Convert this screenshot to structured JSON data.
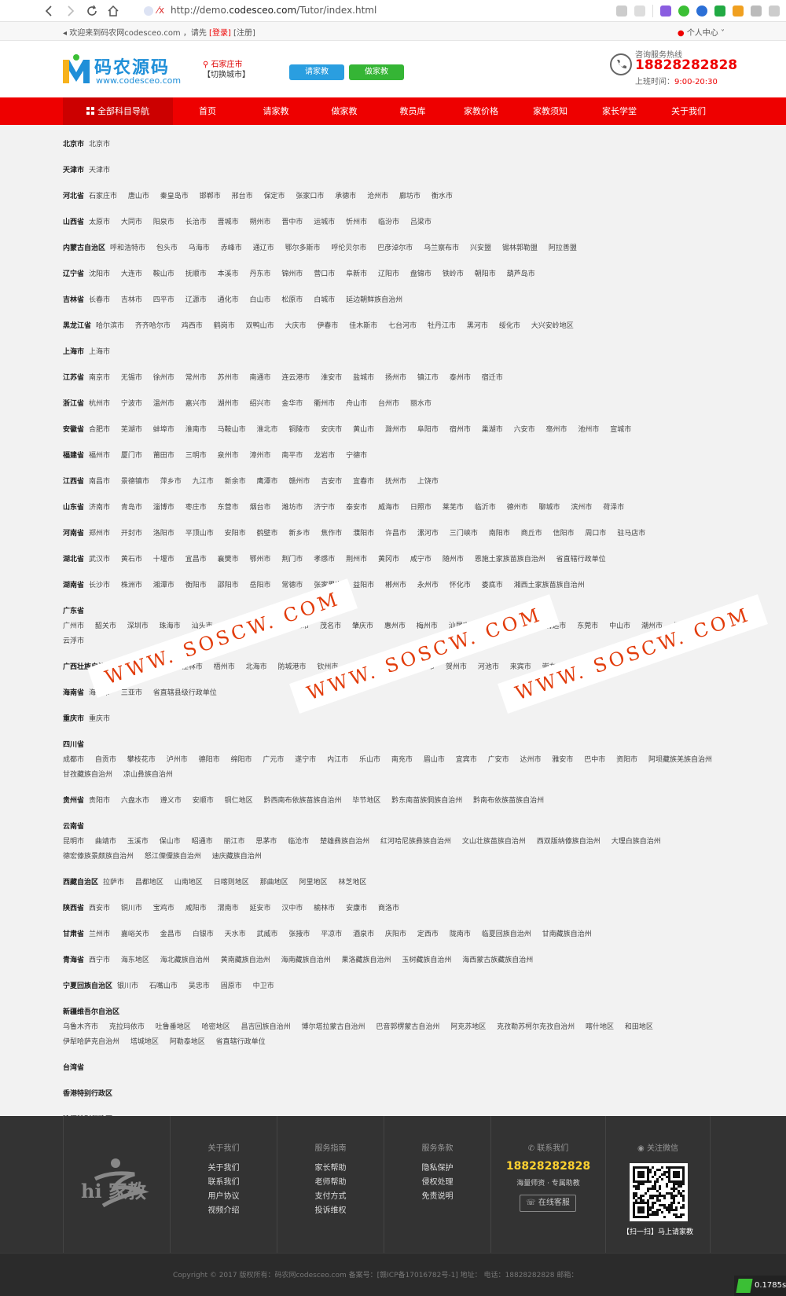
{
  "browser": {
    "url_prefix": "http://demo.",
    "url_host": "codesceo.com",
    "url_path": "/Tutor/index.html",
    "favicon_text": "⁄x"
  },
  "topbar": {
    "welcome": "欢迎来到码农网codesceo.com ，请先",
    "login": "[登录]",
    "register": "[注册]",
    "user_center": "个人中心"
  },
  "header": {
    "logo_title": "码农源码",
    "logo_url": "www.codesceo.com",
    "city_name": "石家庄市",
    "switch_city": "【切换城市】",
    "btn_hire": "请家教",
    "btn_tutor": "做家教",
    "hotline_label": "咨询服务热线",
    "hotline_number": "18828282828",
    "work_hours_label": "上班时间：",
    "work_hours": "9:00-20:30"
  },
  "nav": {
    "all": "全部科目导航",
    "items": [
      "首页",
      "请家教",
      "做家教",
      "教员库",
      "家教价格",
      "家教须知",
      "家长学堂",
      "关于我们"
    ]
  },
  "provinces": [
    {
      "name": "北京市",
      "cities": [
        "北京市"
      ]
    },
    {
      "name": "天津市",
      "cities": [
        "天津市"
      ]
    },
    {
      "name": "河北省",
      "cities": [
        "石家庄市",
        "唐山市",
        "秦皇岛市",
        "邯郸市",
        "邢台市",
        "保定市",
        "张家口市",
        "承德市",
        "沧州市",
        "廊坊市",
        "衡水市"
      ]
    },
    {
      "name": "山西省",
      "cities": [
        "太原市",
        "大同市",
        "阳泉市",
        "长治市",
        "晋城市",
        "朔州市",
        "晋中市",
        "运城市",
        "忻州市",
        "临汾市",
        "吕梁市"
      ]
    },
    {
      "name": "内蒙古自治区",
      "cities": [
        "呼和浩特市",
        "包头市",
        "乌海市",
        "赤峰市",
        "通辽市",
        "鄂尔多斯市",
        "呼伦贝尔市",
        "巴彦淖尔市",
        "乌兰察布市",
        "兴安盟",
        "锡林郭勒盟",
        "阿拉善盟"
      ]
    },
    {
      "name": "辽宁省",
      "cities": [
        "沈阳市",
        "大连市",
        "鞍山市",
        "抚顺市",
        "本溪市",
        "丹东市",
        "锦州市",
        "营口市",
        "阜新市",
        "辽阳市",
        "盘锦市",
        "铁岭市",
        "朝阳市",
        "葫芦岛市"
      ]
    },
    {
      "name": "吉林省",
      "cities": [
        "长春市",
        "吉林市",
        "四平市",
        "辽源市",
        "通化市",
        "白山市",
        "松原市",
        "白城市",
        "延边朝鲜族自治州"
      ]
    },
    {
      "name": "黑龙江省",
      "cities": [
        "哈尔滨市",
        "齐齐哈尔市",
        "鸡西市",
        "鹤岗市",
        "双鸭山市",
        "大庆市",
        "伊春市",
        "佳木斯市",
        "七台河市",
        "牡丹江市",
        "黑河市",
        "绥化市",
        "大兴安岭地区"
      ]
    },
    {
      "name": "上海市",
      "cities": [
        "上海市"
      ]
    },
    {
      "name": "江苏省",
      "cities": [
        "南京市",
        "无锡市",
        "徐州市",
        "常州市",
        "苏州市",
        "南通市",
        "连云港市",
        "淮安市",
        "盐城市",
        "扬州市",
        "镇江市",
        "泰州市",
        "宿迁市"
      ]
    },
    {
      "name": "浙江省",
      "cities": [
        "杭州市",
        "宁波市",
        "温州市",
        "嘉兴市",
        "湖州市",
        "绍兴市",
        "金华市",
        "衢州市",
        "舟山市",
        "台州市",
        "丽水市"
      ]
    },
    {
      "name": "安徽省",
      "cities": [
        "合肥市",
        "芜湖市",
        "蚌埠市",
        "淮南市",
        "马鞍山市",
        "淮北市",
        "铜陵市",
        "安庆市",
        "黄山市",
        "滁州市",
        "阜阳市",
        "宿州市",
        "巢湖市",
        "六安市",
        "亳州市",
        "池州市",
        "宣城市"
      ]
    },
    {
      "name": "福建省",
      "cities": [
        "福州市",
        "厦门市",
        "莆田市",
        "三明市",
        "泉州市",
        "漳州市",
        "南平市",
        "龙岩市",
        "宁德市"
      ]
    },
    {
      "name": "江西省",
      "cities": [
        "南昌市",
        "景德镇市",
        "萍乡市",
        "九江市",
        "新余市",
        "鹰潭市",
        "赣州市",
        "吉安市",
        "宜春市",
        "抚州市",
        "上饶市"
      ]
    },
    {
      "name": "山东省",
      "cities": [
        "济南市",
        "青岛市",
        "淄博市",
        "枣庄市",
        "东营市",
        "烟台市",
        "潍坊市",
        "济宁市",
        "泰安市",
        "威海市",
        "日照市",
        "莱芜市",
        "临沂市",
        "德州市",
        "聊城市",
        "滨州市",
        "荷泽市"
      ]
    },
    {
      "name": "河南省",
      "cities": [
        "郑州市",
        "开封市",
        "洛阳市",
        "平顶山市",
        "安阳市",
        "鹤壁市",
        "新乡市",
        "焦作市",
        "濮阳市",
        "许昌市",
        "漯河市",
        "三门峡市",
        "南阳市",
        "商丘市",
        "信阳市",
        "周口市",
        "驻马店市"
      ]
    },
    {
      "name": "湖北省",
      "cities": [
        "武汉市",
        "黄石市",
        "十堰市",
        "宜昌市",
        "襄樊市",
        "鄂州市",
        "荆门市",
        "孝感市",
        "荆州市",
        "黄冈市",
        "咸宁市",
        "随州市",
        "恩施土家族苗族自治州",
        "省直辖行政单位"
      ]
    },
    {
      "name": "湖南省",
      "cities": [
        "长沙市",
        "株洲市",
        "湘潭市",
        "衡阳市",
        "邵阳市",
        "岳阳市",
        "常德市",
        "张家界市",
        "益阳市",
        "郴州市",
        "永州市",
        "怀化市",
        "娄底市",
        "湘西土家族苗族自治州"
      ]
    },
    {
      "name": "广东省",
      "block": true,
      "cities": [
        "广州市",
        "韶关市",
        "深圳市",
        "珠海市",
        "汕头市",
        "佛山市",
        "江门市",
        "湛江市",
        "茂名市",
        "肇庆市",
        "惠州市",
        "梅州市",
        "汕尾市",
        "河源市",
        "阳江市",
        "清远市",
        "东莞市",
        "中山市",
        "潮州市",
        "揭阳市",
        "云浮市"
      ]
    },
    {
      "name": "广西壮族自治区",
      "cities": [
        "南宁市",
        "柳州市",
        "桂林市",
        "梧州市",
        "北海市",
        "防城港市",
        "钦州市",
        "贵港市",
        "玉林市",
        "百色市",
        "贺州市",
        "河池市",
        "来宾市",
        "崇左市"
      ]
    },
    {
      "name": "海南省",
      "cities": [
        "海口市",
        "三亚市",
        "省直辖县级行政单位"
      ]
    },
    {
      "name": "重庆市",
      "cities": [
        "重庆市"
      ]
    },
    {
      "name": "四川省",
      "block": true,
      "cities": [
        "成都市",
        "自贡市",
        "攀枝花市",
        "泸州市",
        "德阳市",
        "绵阳市",
        "广元市",
        "遂宁市",
        "内江市",
        "乐山市",
        "南充市",
        "眉山市",
        "宜宾市",
        "广安市",
        "达州市",
        "雅安市",
        "巴中市",
        "资阳市",
        "阿坝藏族羌族自治州",
        "甘孜藏族自治州",
        "凉山彝族自治州"
      ]
    },
    {
      "name": "贵州省",
      "cities": [
        "贵阳市",
        "六盘水市",
        "遵义市",
        "安顺市",
        "铜仁地区",
        "黔西南布依族苗族自治州",
        "毕节地区",
        "黔东南苗族侗族自治州",
        "黔南布依族苗族自治州"
      ]
    },
    {
      "name": "云南省",
      "block": true,
      "cities": [
        "昆明市",
        "曲靖市",
        "玉溪市",
        "保山市",
        "昭通市",
        "丽江市",
        "思茅市",
        "临沧市",
        "楚雄彝族自治州",
        "红河哈尼族彝族自治州",
        "文山壮族苗族自治州",
        "西双版纳傣族自治州",
        "大理白族自治州",
        "德宏傣族景颇族自治州",
        "怒江傈僳族自治州",
        "迪庆藏族自治州"
      ]
    },
    {
      "name": "西藏自治区",
      "cities": [
        "拉萨市",
        "昌都地区",
        "山南地区",
        "日喀则地区",
        "那曲地区",
        "阿里地区",
        "林芝地区"
      ]
    },
    {
      "name": "陕西省",
      "cities": [
        "西安市",
        "铜川市",
        "宝鸡市",
        "咸阳市",
        "渭南市",
        "延安市",
        "汉中市",
        "榆林市",
        "安康市",
        "商洛市"
      ]
    },
    {
      "name": "甘肃省",
      "cities": [
        "兰州市",
        "嘉峪关市",
        "金昌市",
        "白银市",
        "天水市",
        "武威市",
        "张掖市",
        "平凉市",
        "酒泉市",
        "庆阳市",
        "定西市",
        "陇南市",
        "临夏回族自治州",
        "甘南藏族自治州"
      ]
    },
    {
      "name": "青海省",
      "cities": [
        "西宁市",
        "海东地区",
        "海北藏族自治州",
        "黄南藏族自治州",
        "海南藏族自治州",
        "果洛藏族自治州",
        "玉树藏族自治州",
        "海西蒙古族藏族自治州"
      ]
    },
    {
      "name": "宁夏回族自治区",
      "cities": [
        "银川市",
        "石嘴山市",
        "吴忠市",
        "固原市",
        "中卫市"
      ]
    },
    {
      "name": "新疆维吾尔自治区",
      "block": true,
      "cities": [
        "乌鲁木齐市",
        "克拉玛依市",
        "吐鲁番地区",
        "哈密地区",
        "昌吉回族自治州",
        "博尔塔拉蒙古自治州",
        "巴音郭楞蒙古自治州",
        "阿克苏地区",
        "克孜勒苏柯尔克孜自治州",
        "喀什地区",
        "和田地区",
        "伊犁哈萨克自治州",
        "塔城地区",
        "阿勒泰地区",
        "省直辖行政单位"
      ]
    },
    {
      "name": "台湾省",
      "cities": []
    },
    {
      "name": "香港特别行政区",
      "cities": []
    },
    {
      "name": "澳门特别行政区",
      "cities": []
    }
  ],
  "watermark": "WWW. SOSCW. COM",
  "footer": {
    "logo_text": "hi 家教",
    "col1_title": "关于我们",
    "col1_links": [
      "关于我们",
      "联系我们",
      "用户协议",
      "视频介绍"
    ],
    "col2_title": "服务指南",
    "col2_links": [
      "家长帮助",
      "老师帮助",
      "支付方式",
      "投诉维权"
    ],
    "col3_title": "服务条款",
    "col3_links": [
      "隐私保护",
      "侵权处理",
      "免责说明"
    ],
    "contact_title": "联系我们",
    "contact_phone": "18828282828",
    "contact_sub": "海量师资 · 专属助教",
    "online_service": "在线客服",
    "wechat_title": "关注微信",
    "qr_caption": "【扫一扫】马上请家教",
    "copyright": "Copyright © 2017 版权所有：码农网codesceo.com    备案号：[赣ICP备17016782号-1]    地址：    电话：18828282828    邮箱："
  },
  "speed": "0.1785s",
  "colors": {
    "brand_red": "#ee0000",
    "brand_blue": "#1f8fd8",
    "accent_green": "#35b535",
    "footer_bg": "#333333"
  }
}
